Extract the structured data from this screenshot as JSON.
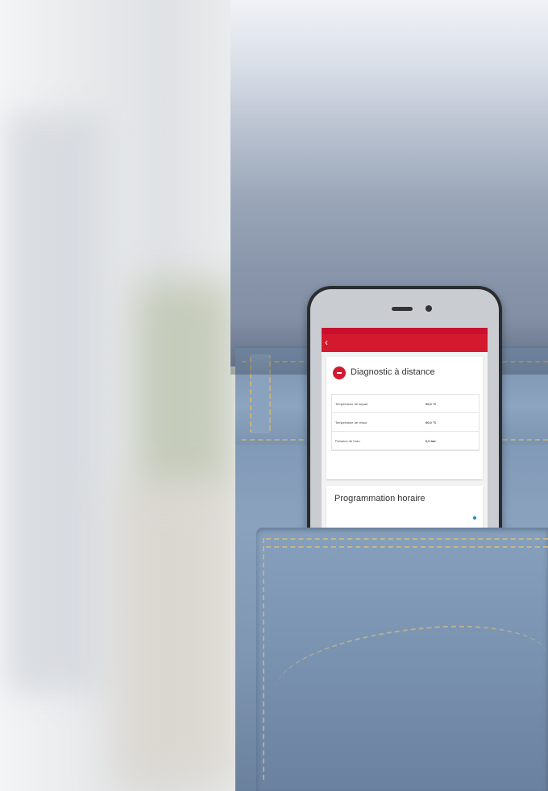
{
  "app": {
    "title": "",
    "diagnostic": {
      "title": "Diagnostic à distance",
      "updated": "",
      "rows": [
        {
          "label": "Température de départ",
          "value": "00,0 °C"
        },
        {
          "label": "Température de retour",
          "value": "00,0 °C"
        },
        {
          "label": "Pression de l'eau",
          "value": "0,0 bar"
        }
      ],
      "more": ""
    },
    "schedule": {
      "title": "Programmation horaire",
      "legend": "",
      "y_labels": [
        "",
        ""
      ]
    }
  },
  "colors": {
    "brand_red": "#d4192e",
    "schedule_blue": "#2a90d0",
    "schedule_green": "#9ccb55"
  },
  "icons": {
    "back": "chevron-left-icon",
    "diagnostic": "minus-circle-icon"
  }
}
